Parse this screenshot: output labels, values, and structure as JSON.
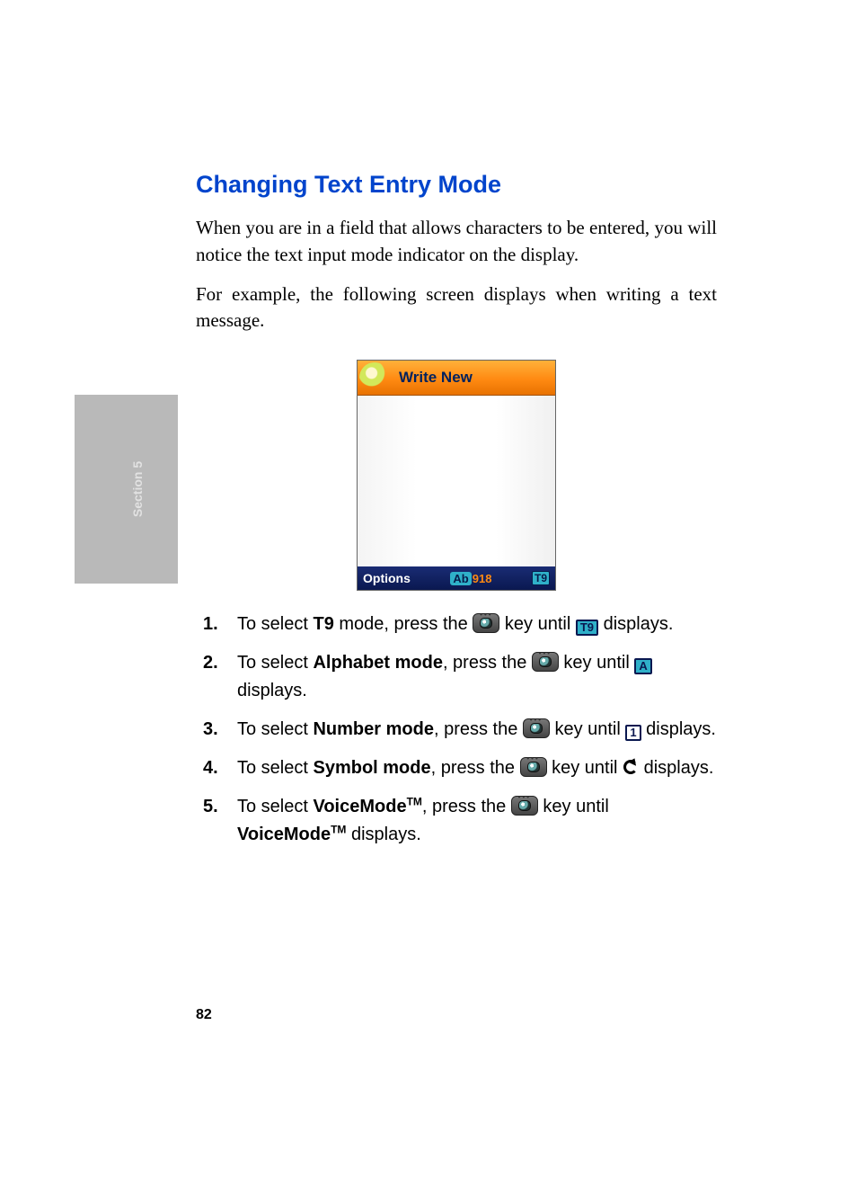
{
  "heading": "Changing Text Entry Mode",
  "para1": "When you are in a field that allows characters to be entered, you will notice the text input mode indicator on the display.",
  "para2": "For example, the following screen displays when writing a text message.",
  "phone": {
    "title": "Write New",
    "options": "Options",
    "ab": "Ab",
    "count": "918",
    "t9": "T9"
  },
  "steps": {
    "s1a": "To select ",
    "s1b": "T9",
    "s1c": " mode, press the ",
    "s1d": " key until ",
    "s1e": " displays.",
    "t9box": "T9",
    "s2a": "To select ",
    "s2b": "Alphabet mode",
    "s2c": ", press the ",
    "s2d": " key until ",
    "s2e": " displays.",
    "abox": "A",
    "s3a": "To select ",
    "s3b": "Number mode",
    "s3c": ", press the ",
    "s3d": " key until ",
    "s3e": " displays.",
    "nbox": "1",
    "s4a": "To select ",
    "s4b": "Symbol mode",
    "s4c": ", press the ",
    "s4d": " key until ",
    "s4e": " displays.",
    "s5a": "To select ",
    "s5b": "VoiceMode",
    "s5tm": "TM",
    "s5c": ", press the ",
    "s5d": " key until ",
    "s5e": "VoiceMode",
    "s5f": " displays."
  },
  "sideTab": "Section 5",
  "pageNum": "82"
}
